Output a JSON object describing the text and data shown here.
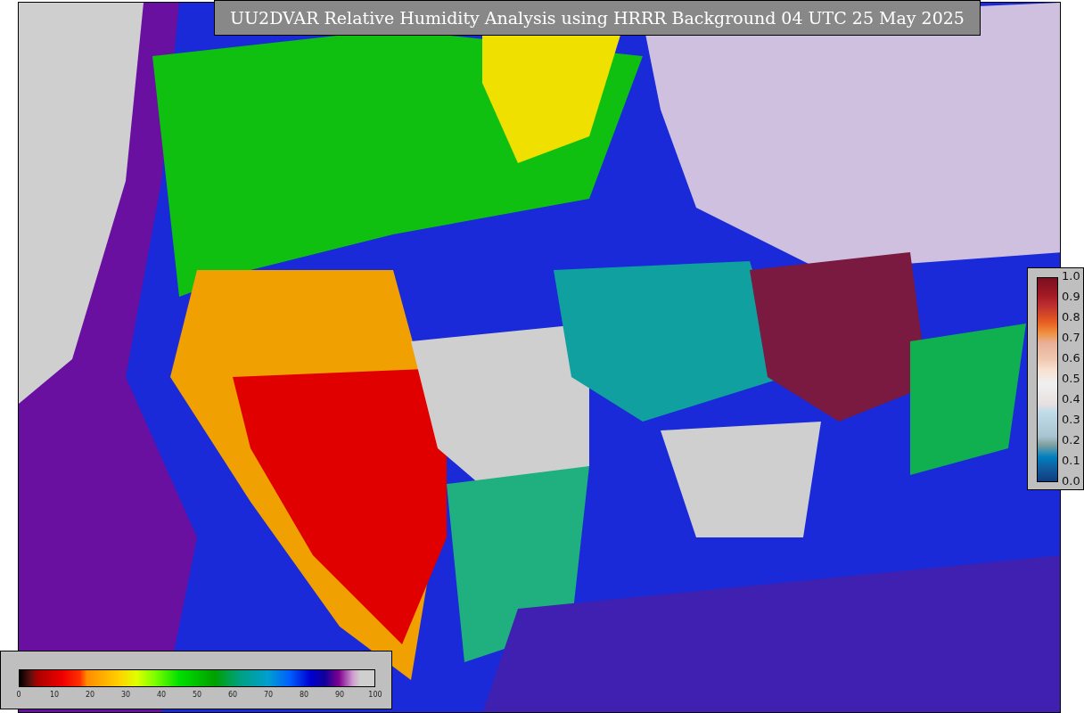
{
  "title": "UU2DVAR Relative Humidity Analysis using HRRR Background 04 UTC 25 May 2025",
  "horizontal_colorbar": {
    "ticks": [
      "0",
      "10",
      "20",
      "30",
      "40",
      "50",
      "60",
      "70",
      "80",
      "90",
      "100"
    ]
  },
  "vertical_colorbar": {
    "ticks": [
      "1.0",
      "0.9",
      "0.8",
      "0.7",
      "0.6",
      "0.5",
      "0.4",
      "0.3",
      "0.2",
      "0.1",
      "0.0"
    ]
  }
}
